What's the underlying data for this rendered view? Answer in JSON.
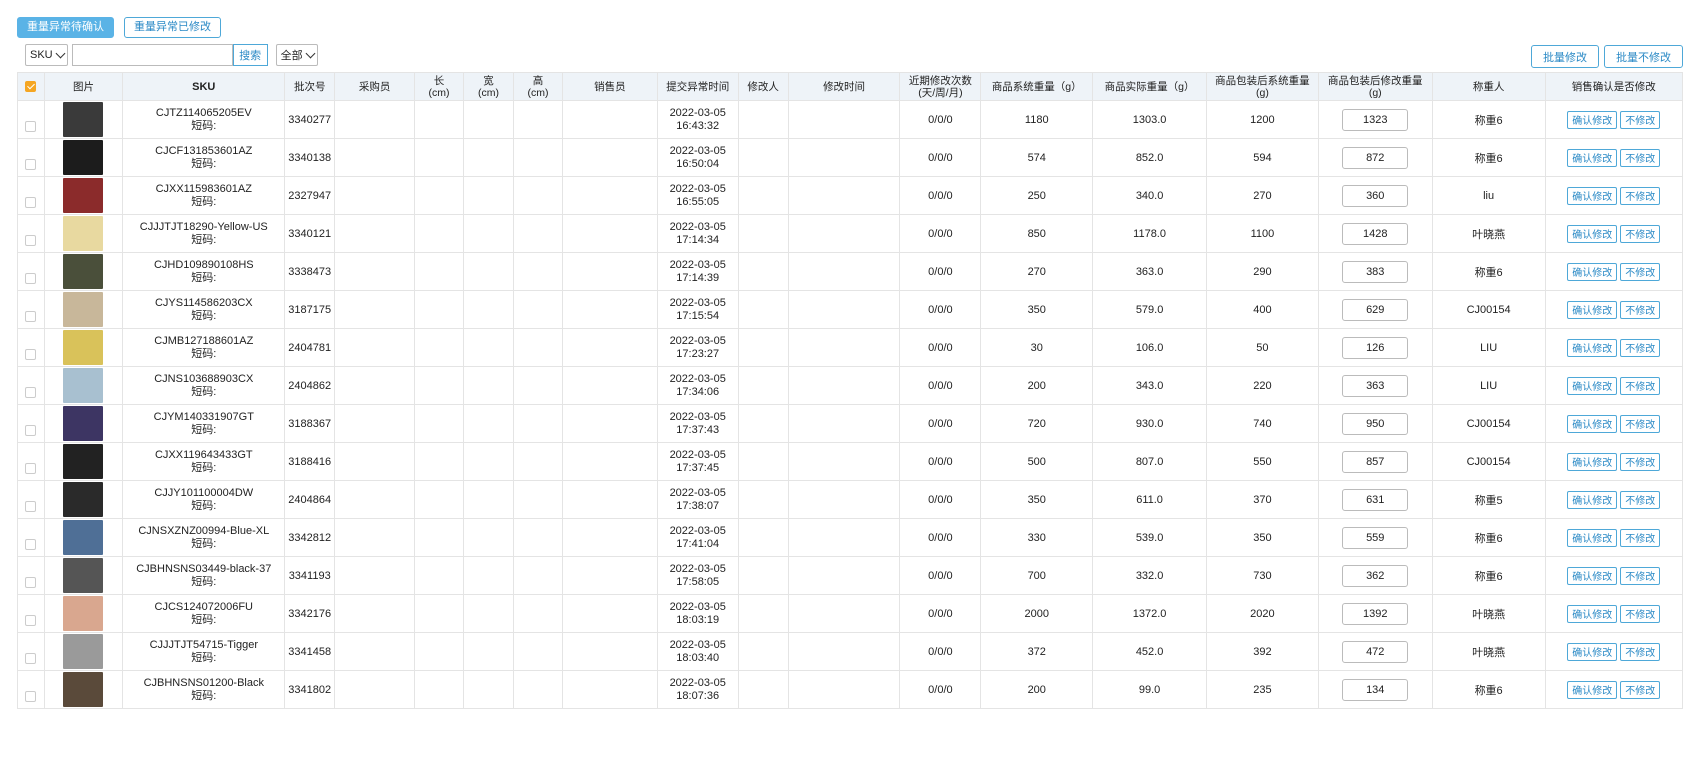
{
  "tabs": [
    {
      "label": "重量异常待确认",
      "active": true
    },
    {
      "label": "重量异常已修改",
      "active": false
    }
  ],
  "search": {
    "field_select": "SKU",
    "query": "",
    "button": "搜索",
    "filter_select": "全部"
  },
  "batch": {
    "modify": "批量修改",
    "no_modify": "批量不修改"
  },
  "columns": [
    "图片",
    "SKU",
    "批次号",
    "采购员",
    "长\n(cm)",
    "宽\n(cm)",
    "高\n(cm)",
    "销售员",
    "提交异常时间",
    "修改人",
    "修改时间",
    "近期修改次数\n(天/周/月)",
    "商品系统重量（g）",
    "商品实际重量（g）",
    "商品包装后系统重量\n(g)",
    "商品包装后修改重量\n(g)",
    "称重人",
    "销售确认是否修改"
  ],
  "row_actions": {
    "confirm": "确认修改",
    "reject": "不修改"
  },
  "short_code_label": "短码:",
  "colors": {
    "accent": "#5ab3e6",
    "header_bg": "#eef3f8",
    "checkbox": "#f5a623"
  },
  "rows": [
    {
      "sku": "CJTZ114065205EV",
      "batch": "3340277",
      "date": "2022-03-05",
      "time": "16:43:32",
      "count": "0/0/0",
      "sys": "1180",
      "actual": "1303.0",
      "pkg_sys": "1200",
      "pkg_edit": "1323",
      "weigher": "称重6",
      "img": "#3a3a3a"
    },
    {
      "sku": "CJCF131853601AZ",
      "batch": "3340138",
      "date": "2022-03-05",
      "time": "16:50:04",
      "count": "0/0/0",
      "sys": "574",
      "actual": "852.0",
      "pkg_sys": "594",
      "pkg_edit": "872",
      "weigher": "称重6",
      "img": "#1c1c1c"
    },
    {
      "sku": "CJXX115983601AZ",
      "batch": "2327947",
      "date": "2022-03-05",
      "time": "16:55:05",
      "count": "0/0/0",
      "sys": "250",
      "actual": "340.0",
      "pkg_sys": "270",
      "pkg_edit": "360",
      "weigher": "liu",
      "img": "#8b2b2b"
    },
    {
      "sku": "CJJJTJT18290-Yellow-US",
      "batch": "3340121",
      "date": "2022-03-05",
      "time": "17:14:34",
      "count": "0/0/0",
      "sys": "850",
      "actual": "1178.0",
      "pkg_sys": "1100",
      "pkg_edit": "1428",
      "weigher": "叶晓燕",
      "img": "#e8d9a0"
    },
    {
      "sku": "CJHD109890108HS",
      "batch": "3338473",
      "date": "2022-03-05",
      "time": "17:14:39",
      "count": "0/0/0",
      "sys": "270",
      "actual": "363.0",
      "pkg_sys": "290",
      "pkg_edit": "383",
      "weigher": "称重6",
      "img": "#4a4f3a"
    },
    {
      "sku": "CJYS114586203CX",
      "batch": "3187175",
      "date": "2022-03-05",
      "time": "17:15:54",
      "count": "0/0/0",
      "sys": "350",
      "actual": "579.0",
      "pkg_sys": "400",
      "pkg_edit": "629",
      "weigher": "CJ00154",
      "img": "#c8b79a"
    },
    {
      "sku": "CJMB127188601AZ",
      "batch": "2404781",
      "date": "2022-03-05",
      "time": "17:23:27",
      "count": "0/0/0",
      "sys": "30",
      "actual": "106.0",
      "pkg_sys": "50",
      "pkg_edit": "126",
      "weigher": "LIU",
      "img": "#d9c25a"
    },
    {
      "sku": "CJNS103688903CX",
      "batch": "2404862",
      "date": "2022-03-05",
      "time": "17:34:06",
      "count": "0/0/0",
      "sys": "200",
      "actual": "343.0",
      "pkg_sys": "220",
      "pkg_edit": "363",
      "weigher": "LIU",
      "img": "#a8c0d0"
    },
    {
      "sku": "CJYM140331907GT",
      "batch": "3188367",
      "date": "2022-03-05",
      "time": "17:37:43",
      "count": "0/0/0",
      "sys": "720",
      "actual": "930.0",
      "pkg_sys": "740",
      "pkg_edit": "950",
      "weigher": "CJ00154",
      "img": "#3d3563"
    },
    {
      "sku": "CJXX119643433GT",
      "batch": "3188416",
      "date": "2022-03-05",
      "time": "17:37:45",
      "count": "0/0/0",
      "sys": "500",
      "actual": "807.0",
      "pkg_sys": "550",
      "pkg_edit": "857",
      "weigher": "CJ00154",
      "img": "#222222"
    },
    {
      "sku": "CJJY101100004DW",
      "batch": "2404864",
      "date": "2022-03-05",
      "time": "17:38:07",
      "count": "0/0/0",
      "sys": "350",
      "actual": "611.0",
      "pkg_sys": "370",
      "pkg_edit": "631",
      "weigher": "称重5",
      "img": "#2a2a2a"
    },
    {
      "sku": "CJNSXZNZ00994-Blue-XL",
      "batch": "3342812",
      "date": "2022-03-05",
      "time": "17:41:04",
      "count": "0/0/0",
      "sys": "330",
      "actual": "539.0",
      "pkg_sys": "350",
      "pkg_edit": "559",
      "weigher": "称重6",
      "img": "#4f6f96"
    },
    {
      "sku": "CJBHNSNS03449-black-37",
      "batch": "3341193",
      "date": "2022-03-05",
      "time": "17:58:05",
      "count": "0/0/0",
      "sys": "700",
      "actual": "332.0",
      "pkg_sys": "730",
      "pkg_edit": "362",
      "weigher": "称重6",
      "img": "#555555"
    },
    {
      "sku": "CJCS124072006FU",
      "batch": "3342176",
      "date": "2022-03-05",
      "time": "18:03:19",
      "count": "0/0/0",
      "sys": "2000",
      "actual": "1372.0",
      "pkg_sys": "2020",
      "pkg_edit": "1392",
      "weigher": "叶晓燕",
      "img": "#d9a78f"
    },
    {
      "sku": "CJJJTJT54715-Tigger",
      "batch": "3341458",
      "date": "2022-03-05",
      "time": "18:03:40",
      "count": "0/0/0",
      "sys": "372",
      "actual": "452.0",
      "pkg_sys": "392",
      "pkg_edit": "472",
      "weigher": "叶晓燕",
      "img": "#9a9a9a"
    },
    {
      "sku": "CJBHNSNS01200-Black",
      "batch": "3341802",
      "date": "2022-03-05",
      "time": "18:07:36",
      "count": "0/0/0",
      "sys": "200",
      "actual": "99.0",
      "pkg_sys": "235",
      "pkg_edit": "134",
      "weigher": "称重6",
      "img": "#5a4a3a"
    }
  ]
}
